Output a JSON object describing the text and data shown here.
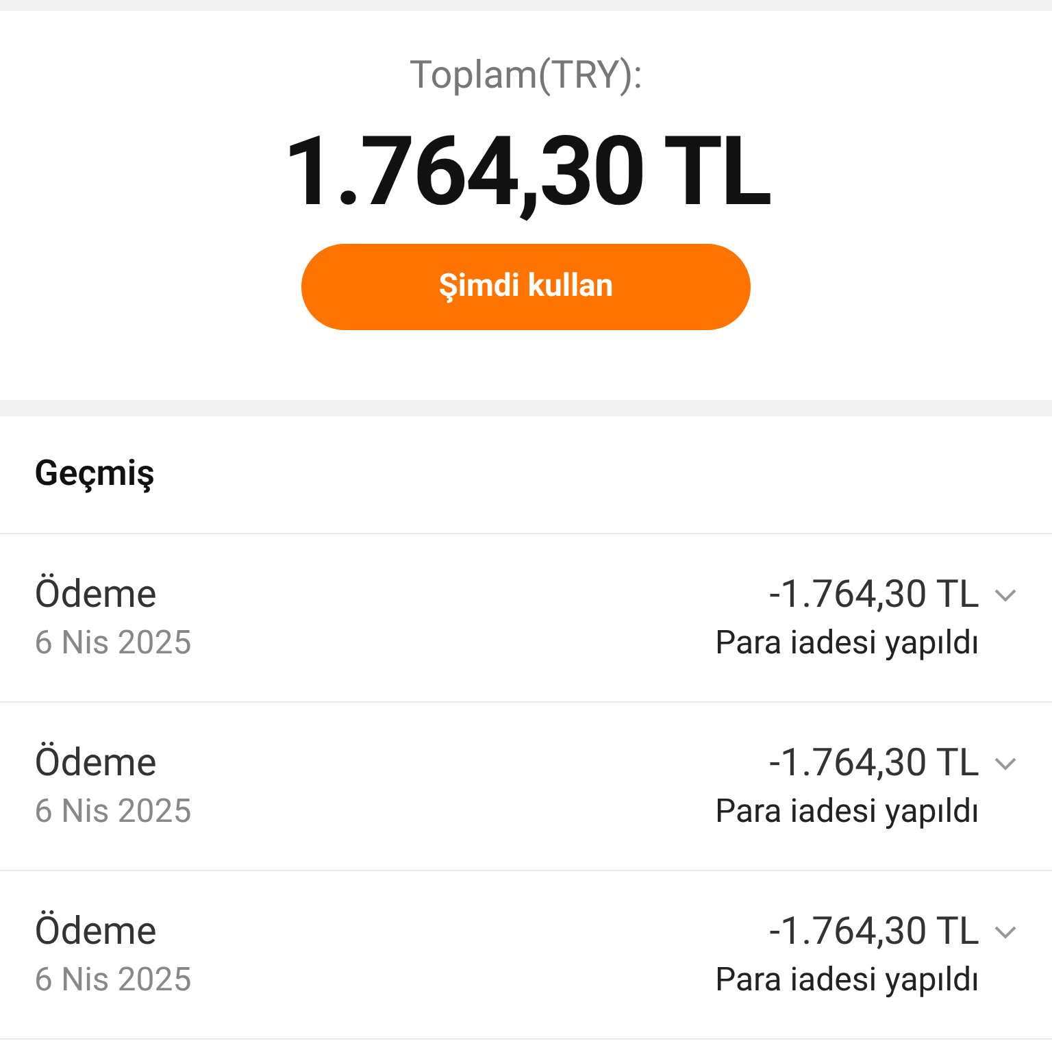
{
  "balance": {
    "label": "Toplam(TRY):",
    "amount": "1.764,30 TL",
    "button": "Şimdi kullan"
  },
  "history": {
    "title": "Geçmiş",
    "rows": [
      {
        "title": "Ödeme",
        "date": "6 Nis 2025",
        "amount": "-1.764,30 TL",
        "status": "Para iadesi yapıldı",
        "expanded": false
      },
      {
        "title": "Ödeme",
        "date": "6 Nis 2025",
        "amount": "-1.764,30 TL",
        "status": "Para iadesi yapıldı",
        "expanded": false
      },
      {
        "title": "Ödeme",
        "date": "6 Nis 2025",
        "amount": "-1.764,30 TL",
        "status": "Para iadesi yapıldı",
        "expanded": false
      }
    ]
  }
}
